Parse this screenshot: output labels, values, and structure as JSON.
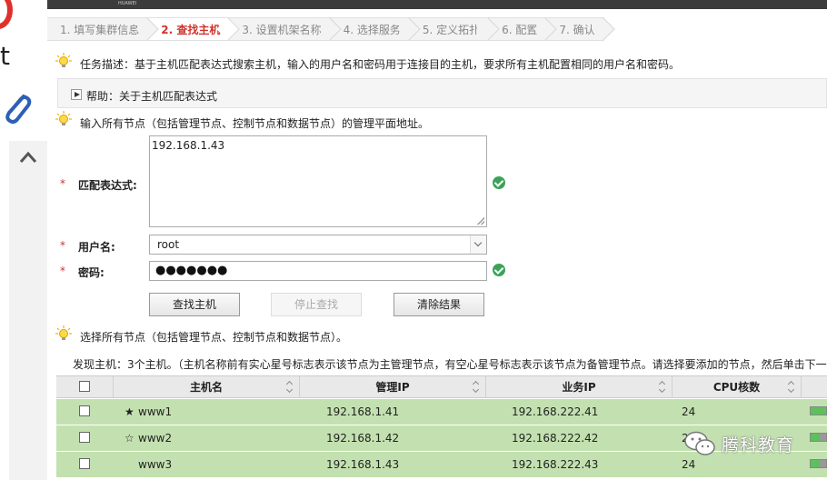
{
  "wizard": {
    "steps": [
      "1. 填写集群信息",
      "2. 查找主机",
      "3. 设置机架名称",
      "4. 选择服务",
      "5. 定义拓扑",
      "6. 配置",
      "7. 确认"
    ],
    "active_index": 1
  },
  "task_description": "任务描述：基于主机匹配表达式搜索主机，输入的用户名和密码用于连接目的主机，要求所有主机配置相同的用户名和密码。",
  "help_label": "帮助：关于主机匹配表达式",
  "node_hint": "输入所有节点（包括管理节点、控制节点和数据节点）的管理平面地址。",
  "form": {
    "required_mark": "*",
    "expr_label": "匹配表达式:",
    "expr_value": "192.168.1.43",
    "user_label": "用户名:",
    "user_value": "root",
    "pwd_label": "密码:",
    "pwd_mask": "●●●●●●●"
  },
  "buttons": {
    "find": "查找主机",
    "stop": "停止查找",
    "clear": "清除结果"
  },
  "select_hint": "选择所有节点（包括管理节点、控制节点和数据节点）。",
  "found_text": "发现主机：3个主机。（主机名称前有实心星号标志表示该节点为主管理节点，有空心星号标志表示该节点为备管理节点。请选择要添加的节点，然后单击下一",
  "table": {
    "headers": [
      "主机名",
      "管理IP",
      "业务IP",
      "CPU核数"
    ],
    "rows": [
      {
        "star": "★",
        "host": "www1",
        "mgmt_ip": "192.168.1.41",
        "svc_ip": "192.168.222.41",
        "cpu": "24",
        "usage": 1.0
      },
      {
        "star": "☆",
        "host": "www2",
        "mgmt_ip": "192.168.1.42",
        "svc_ip": "192.168.222.42",
        "cpu": "24",
        "usage": 0.6
      },
      {
        "star": "",
        "host": "www3",
        "mgmt_ip": "192.168.1.43",
        "svc_ip": "192.168.222.43",
        "cpu": "24",
        "usage": 0.6
      }
    ]
  },
  "left_strip": {
    "letter": "t"
  },
  "header_tag": "HUAWEI",
  "watermark": "腾科教育",
  "colors": {
    "accent_red": "#d0342c",
    "row_green": "#c3e1b0",
    "ok_green": "#3aa35a"
  }
}
